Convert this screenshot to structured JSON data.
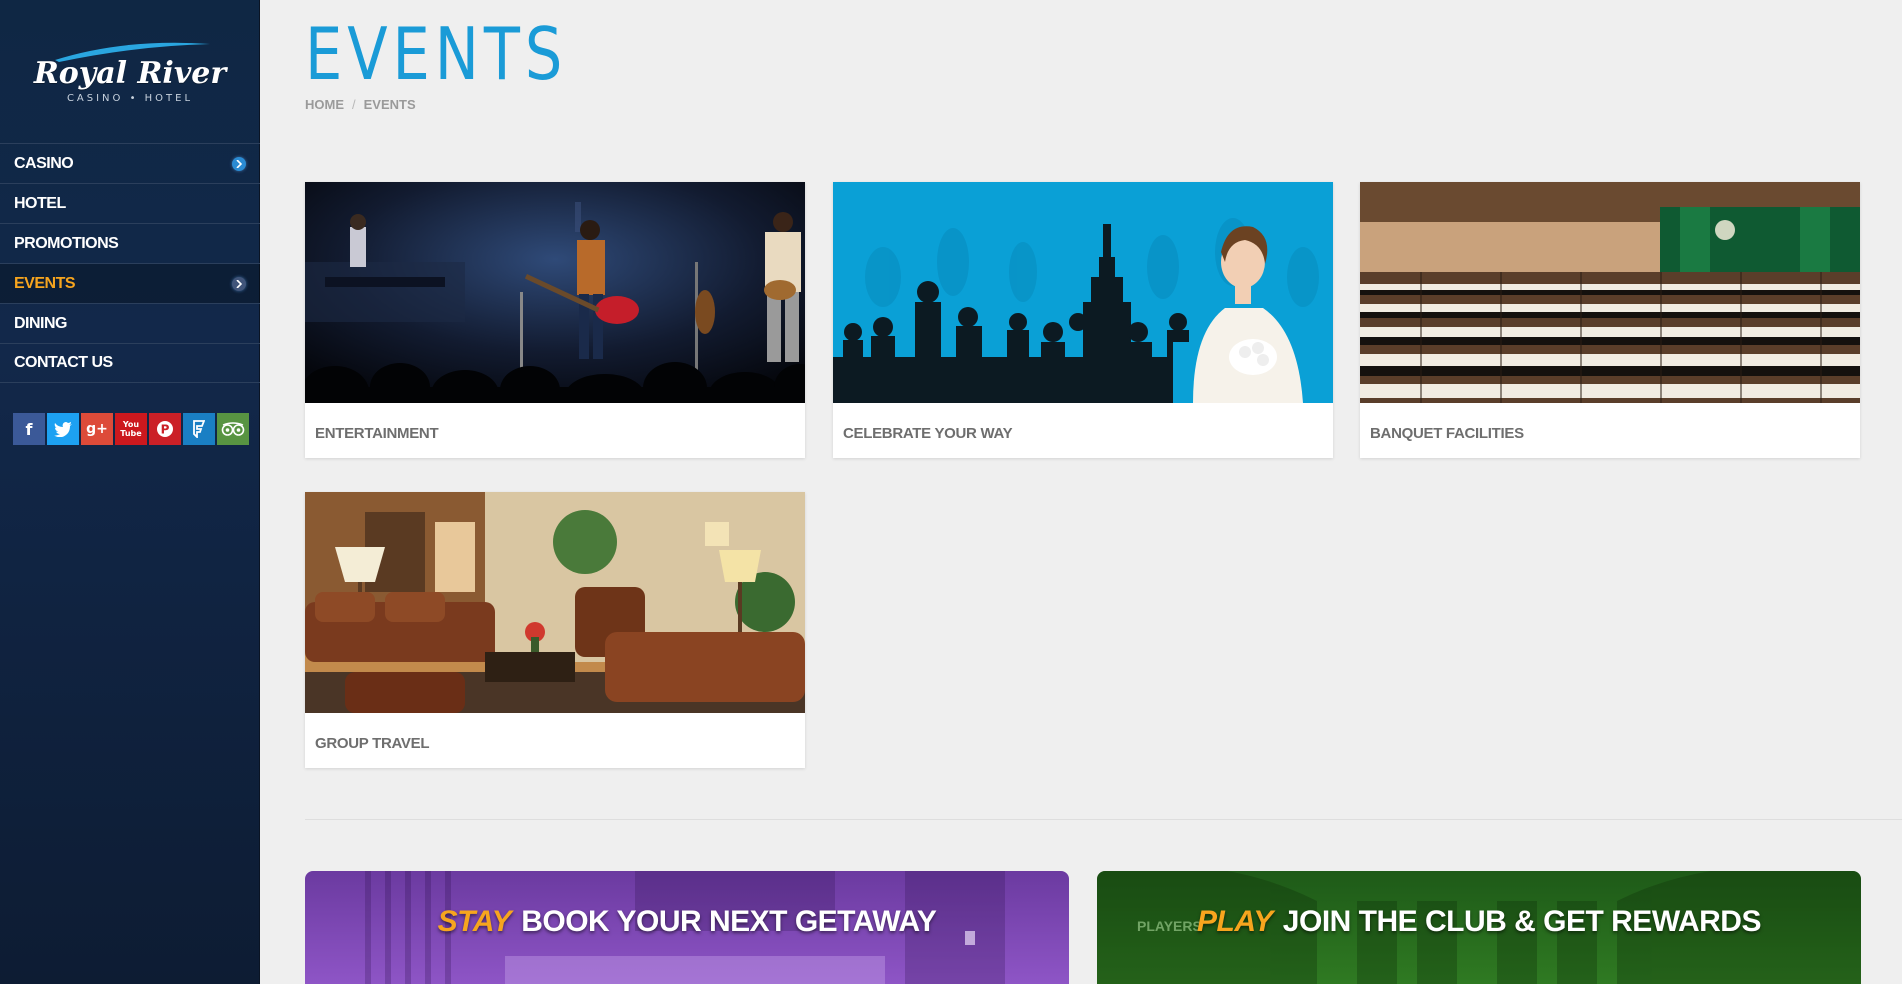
{
  "brand": {
    "name": "Royal River",
    "subtitle": "CASINO • HOTEL"
  },
  "nav": {
    "items": [
      {
        "label": "CASINO",
        "has_arrow": true
      },
      {
        "label": "HOTEL",
        "has_arrow": false
      },
      {
        "label": "PROMOTIONS",
        "has_arrow": false
      },
      {
        "label": "EVENTS",
        "has_arrow": true,
        "active": true
      },
      {
        "label": "DINING",
        "has_arrow": false
      },
      {
        "label": "CONTACT US",
        "has_arrow": false
      }
    ],
    "active_color": "#f7a51e"
  },
  "social": [
    {
      "icon": "facebook-icon",
      "glyph": "f",
      "color": "#3b5998"
    },
    {
      "icon": "twitter-icon",
      "glyph": "🐦",
      "color": "#1da1f2"
    },
    {
      "icon": "google-plus-icon",
      "glyph": "g+",
      "color": "#dd4b39"
    },
    {
      "icon": "youtube-icon",
      "glyph": "You Tube",
      "color": "#cc181e"
    },
    {
      "icon": "pinterest-icon",
      "glyph": "P",
      "color": "#cb2027"
    },
    {
      "icon": "foursquare-icon",
      "glyph": "F",
      "color": "#1a7fc4"
    },
    {
      "icon": "tripadvisor-icon",
      "glyph": "oo",
      "color": "#589442"
    }
  ],
  "page": {
    "title": "EVENTS",
    "title_color": "#1a9bd7",
    "breadcrumb": [
      "HOME",
      "EVENTS"
    ]
  },
  "cards": [
    {
      "label": "ENTERTAINMENT"
    },
    {
      "label": "CELEBRATE YOUR WAY"
    },
    {
      "label": "BANQUET FACILITIES"
    },
    {
      "label": "GROUP TRAVEL"
    }
  ],
  "promos": [
    {
      "accent": "STAY",
      "text": "BOOK YOUR NEXT GETAWAY",
      "color": "#7a3fb0"
    },
    {
      "accent": "PLAY",
      "text": "JOIN THE CLUB & GET REWARDS",
      "color": "#2f7a22"
    }
  ]
}
